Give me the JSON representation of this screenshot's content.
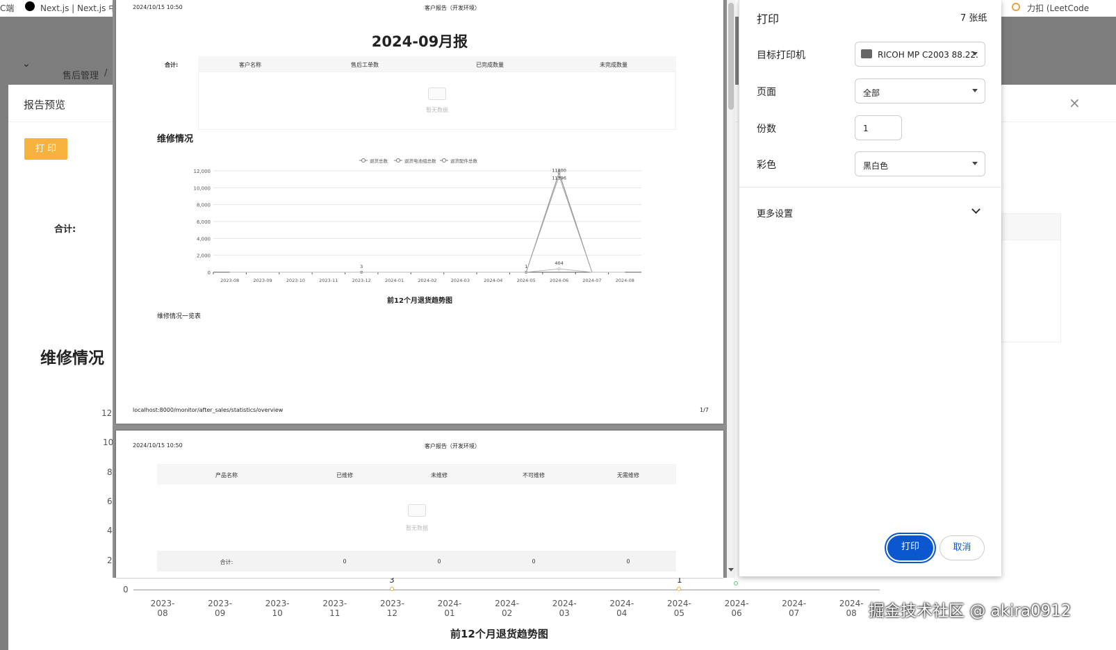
{
  "bookmarks": [
    {
      "label": "C端"
    },
    {
      "label": "Next.js | Next.js 中"
    },
    {
      "label": "力扣 (LeetCode"
    }
  ],
  "background": {
    "breadcrumb": "售后管理",
    "breadcrumb_sep": "/",
    "modal_title": "报告预览",
    "print_button": "打 印",
    "total_label": "合计:",
    "section_title": "维修情况",
    "y_ticks": [
      "12",
      "10",
      "8",
      "6",
      "4",
      "2",
      "0"
    ],
    "x_ticks": [
      "2023-08",
      "2023-09",
      "2023-10",
      "2023-11",
      "2023-12",
      "2024-01",
      "2024-02",
      "2024-03",
      "2024-04",
      "2024-05",
      "2024-06",
      "2024-07",
      "2024-08"
    ],
    "point_labels": {
      "dec": "3",
      "may": "1"
    },
    "chart_title": "前12个月退货趋势图"
  },
  "preview": {
    "page1": {
      "header_date": "2024/10/15 10:50",
      "header_title": "客户报告（开发环境）",
      "report_title": "2024-09月报",
      "total_label": "合计:",
      "columns": [
        "客户名称",
        "售后工单数",
        "已完成数量",
        "未完成数量"
      ],
      "empty_text": "暂无数据",
      "section_title": "维修情况",
      "footer_url": "localhost:8000/monitor/after_sales/statistics/overview",
      "footer_page": "1/7",
      "list_title": "维修情况一览表"
    },
    "page2": {
      "header_date": "2024/10/15 10:50",
      "header_title": "客户报告（开发环境）",
      "columns": [
        "产品名称",
        "已维修",
        "未维修",
        "不可维修",
        "无需维修"
      ],
      "empty_text": "暂无数据",
      "total_row": [
        "合计:",
        "0",
        "0",
        "0",
        "0"
      ]
    }
  },
  "chart_data": {
    "type": "line",
    "title": "前12个月退货趋势图",
    "categories": [
      "2023-08",
      "2023-09",
      "2023-10",
      "2023-11",
      "2023-12",
      "2024-01",
      "2024-02",
      "2024-03",
      "2024-04",
      "2024-05",
      "2024-06",
      "2024-07",
      "2024-08"
    ],
    "series": [
      {
        "name": "退货总数",
        "values": [
          0,
          0,
          0,
          0,
          3,
          0,
          0,
          0,
          0,
          1,
          11800,
          0,
          0
        ]
      },
      {
        "name": "退货电池组总数",
        "values": [
          0,
          0,
          0,
          0,
          0,
          0,
          0,
          0,
          0,
          0,
          11396,
          0,
          0
        ]
      },
      {
        "name": "退货配件总数",
        "values": [
          0,
          0,
          0,
          0,
          0,
          0,
          0,
          0,
          0,
          0,
          404,
          0,
          0
        ]
      }
    ],
    "y_ticks": [
      "0",
      "2,000",
      "4,000",
      "6,000",
      "8,000",
      "10,000",
      "12,000"
    ],
    "ylim": [
      0,
      12000
    ],
    "data_labels": [
      "3",
      "1",
      "11800",
      "11396",
      "404"
    ],
    "legend_position": "top"
  },
  "dialog": {
    "title": "打印",
    "sheets": "7 张纸",
    "printer_label": "目标打印机",
    "printer_value": "RICOH MP C2003 88.22.",
    "pages_label": "页面",
    "pages_value": "全部",
    "copies_label": "份数",
    "copies_value": "1",
    "color_label": "彩色",
    "color_value": "黑白色",
    "more_label": "更多设置",
    "print_btn": "打印",
    "cancel_btn": "取消",
    "accent": "#0b57d0"
  },
  "watermark": "掘金技术社区 @ akira0912"
}
